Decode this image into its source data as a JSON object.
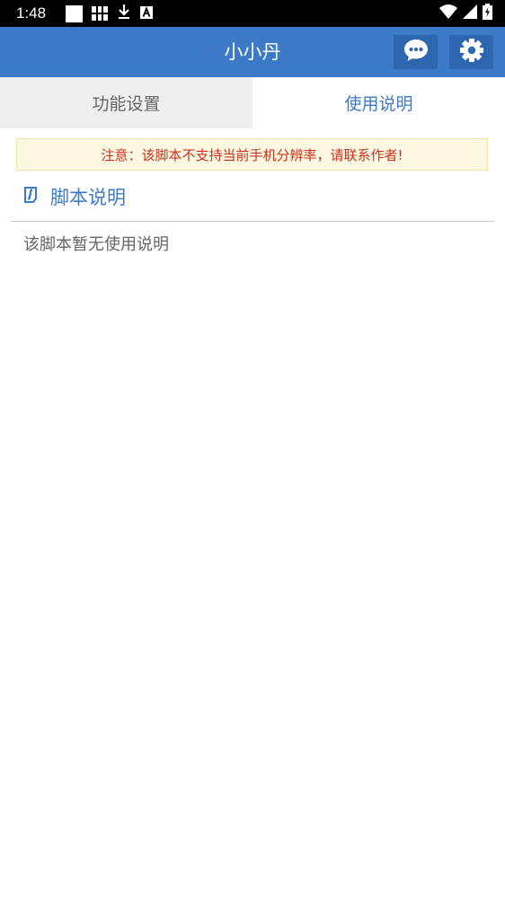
{
  "status_bar": {
    "time": "1:48",
    "icons": [
      "white-square-icon",
      "grid-icon",
      "download-icon",
      "a-badge-icon",
      "wifi-icon",
      "signal-icon",
      "battery-charging-icon"
    ]
  },
  "app_bar": {
    "title": "小小丹",
    "chat_icon": "chat-bubble-icon",
    "settings_icon": "gear-icon"
  },
  "tabs": [
    {
      "label": "功能设置",
      "active": false
    },
    {
      "label": "使用说明",
      "active": true
    }
  ],
  "notice": {
    "text": "注意：该脚本不支持当前手机分辨率，请联系作者!"
  },
  "section": {
    "icon": "info-icon",
    "title": "脚本说明"
  },
  "description": {
    "text": "该脚本暂无使用说明"
  },
  "colors": {
    "primary": "#3c7ac8",
    "primary_dark": "#2f66b0",
    "notice_bg": "#fdf8e2",
    "notice_text": "#c9301d",
    "tab_inactive_bg": "#efefef"
  }
}
